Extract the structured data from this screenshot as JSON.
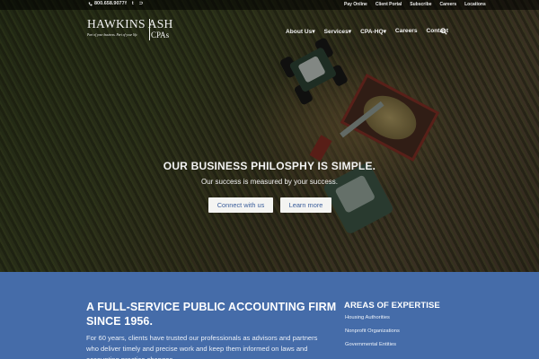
{
  "topbar": {
    "phone": "800.658.9077",
    "social_icons": [
      "facebook-icon",
      "twitter-icon",
      "rss-icon"
    ],
    "social_glyphs": [
      "f",
      "t",
      "⊃"
    ],
    "links": [
      "Pay Online",
      "Client Portal",
      "Subscribe",
      "Careers",
      "Locations"
    ]
  },
  "logo": {
    "name": "HAWKINS ASH",
    "suffix": "CPAs",
    "tagline": "Part of your business. Part of your life."
  },
  "nav": {
    "items": [
      "About Us",
      "Services",
      "CPA-HQ",
      "Careers",
      "Contact"
    ],
    "has_dropdown": [
      true,
      true,
      true,
      false,
      false
    ],
    "chevron": "▾"
  },
  "hero": {
    "title": "OUR BUSINESS PHILOSPHY IS SIMPLE.",
    "subtitle": "Our success is measured by your success.",
    "buttons": [
      "Connect with us",
      "Learn more"
    ]
  },
  "about": {
    "title": "A FULL-SERVICE PUBLIC ACCOUNTING FIRM SINCE 1956.",
    "body": "For 60 years, clients have trusted our professionals as advisors and partners who deliver timely and precise work and keep them informed on laws and accounting practice changes."
  },
  "expertise": {
    "title": "AREAS OF EXPERTISE",
    "items": [
      "Housing Authorities",
      "Nonprofit Organizations",
      "Governmental Entities"
    ]
  },
  "colors": {
    "accent_blue": "#456ca9",
    "button_text": "#3b5e9b"
  }
}
